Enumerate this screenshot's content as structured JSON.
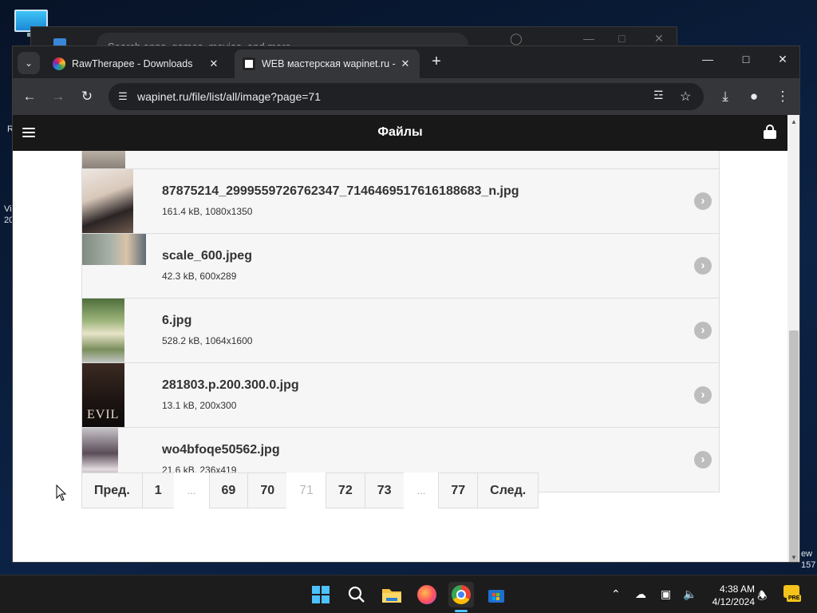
{
  "desktop": {
    "left_fragments": [
      "R",
      "Vi",
      "20"
    ],
    "right_fragments": [
      "ew",
      "157"
    ]
  },
  "background_window": {
    "search_placeholder": "Search apps, games, movies, and more"
  },
  "browser": {
    "tabs": [
      {
        "title": "RawTherapee - Downloads",
        "active": false
      },
      {
        "title": "WEB мастерская wapinet.ru - Фа",
        "active": true
      }
    ],
    "url": "wapinet.ru/file/list/all/image?page=71"
  },
  "page": {
    "title": "Файлы",
    "files": [
      {
        "name": "87875214_2999559726762347_7146469517616188683_n.jpg",
        "meta": "161.4 kB, 1080x1350"
      },
      {
        "name": "scale_600.jpeg",
        "meta": "42.3 kB, 600x289"
      },
      {
        "name": "6.jpg",
        "meta": "528.2 kB, 1064x1600"
      },
      {
        "name": "281803.p.200.300.0.jpg",
        "meta": "13.1 kB, 200x300",
        "thumb_text": "EVIL"
      },
      {
        "name": "wo4bfoqe50562.jpg",
        "meta": "21.6 kB, 236x419"
      }
    ],
    "pager": {
      "prev": "Пред.",
      "next": "След.",
      "ellipsis": "...",
      "pages": [
        "1",
        "69",
        "70",
        "71",
        "72",
        "73",
        "77"
      ],
      "current": "71"
    }
  },
  "taskbar": {
    "time": "4:38 AM",
    "date": "4/12/2024",
    "badge": "PRE"
  }
}
